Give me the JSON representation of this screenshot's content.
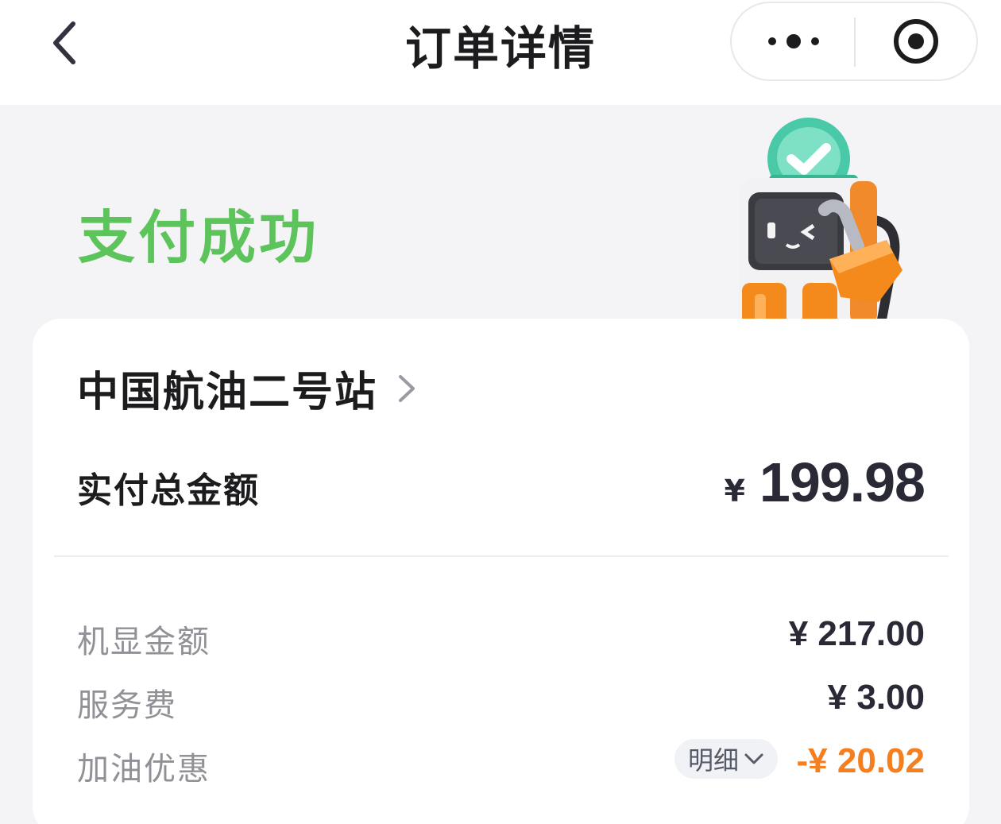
{
  "navbar": {
    "title": "订单详情"
  },
  "status": {
    "title": "支付成功"
  },
  "order": {
    "station_name": "中国航油二号站",
    "total_label": "实付总金额",
    "total_currency": "¥",
    "total_value": "199.98"
  },
  "breakdown": {
    "rows": [
      {
        "label": "机显金额",
        "value": "¥ 217.00"
      },
      {
        "label": "服务费",
        "value": "¥ 3.00"
      },
      {
        "label": "加油优惠",
        "value": "-¥ 20.02",
        "detail_label": "明细"
      }
    ]
  },
  "colors": {
    "success": "#5cc45a",
    "discount": "#f57f1f",
    "text_primary": "#1c1c1e",
    "text_secondary": "#909096",
    "background": "#f4f4f6"
  },
  "icons": {
    "back": "chevron-left-icon",
    "more": "more-dots-icon",
    "close": "target-circle-icon",
    "station_link": "chevron-right-icon",
    "detail_toggle": "chevron-down-icon"
  }
}
